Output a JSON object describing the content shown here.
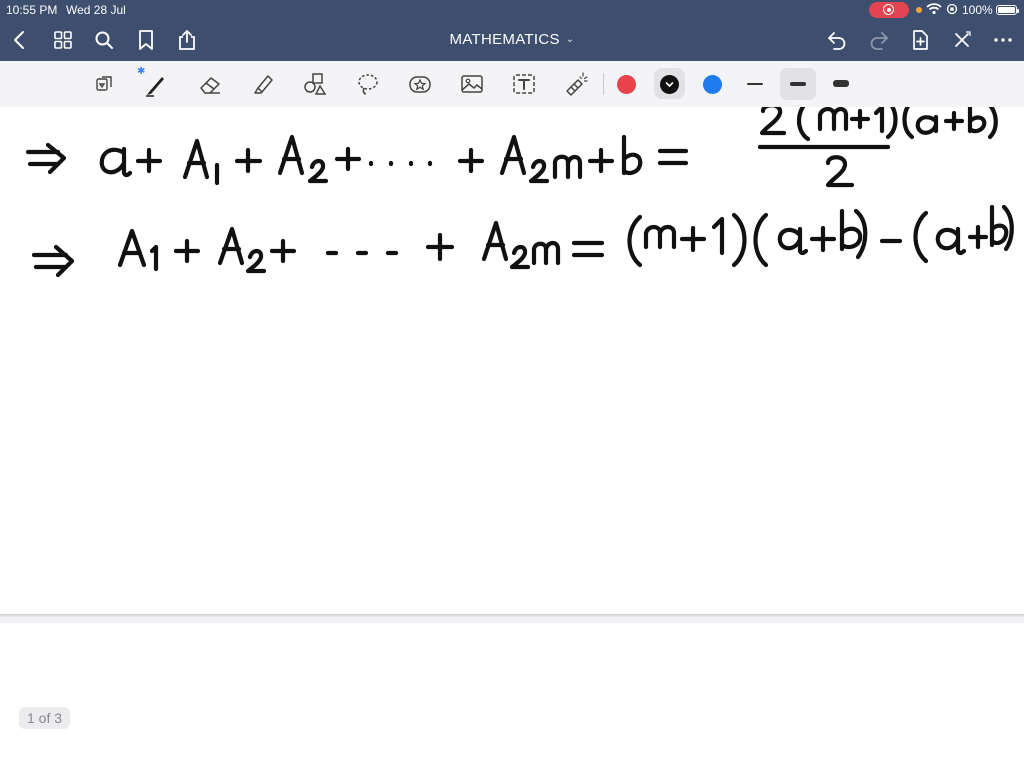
{
  "status": {
    "time": "10:55 PM",
    "date": "Wed 28 Jul",
    "battery": "100%"
  },
  "nav": {
    "title": "MATHEMATICS",
    "title_chevron": "⌄",
    "icons": [
      "back-icon",
      "grid-icon",
      "search-icon",
      "bookmark-icon",
      "share-icon",
      "undo-icon",
      "redo-icon",
      "add-page-icon",
      "close-icon",
      "more-icon"
    ]
  },
  "toolbar": {
    "tools": [
      "lasso-icon",
      "pen-icon",
      "eraser-icon",
      "highlighter-icon",
      "shapes-icon",
      "lasso-select-icon",
      "sticker-icon",
      "image-icon",
      "text-icon",
      "laser-pointer-icon"
    ],
    "bluetooth_glyph": "✱",
    "colors": [
      "#e8424d",
      "#111111",
      "#1f7bf0"
    ],
    "selected_color": "#111111"
  },
  "handwriting": {
    "line1_prefix": "⇒",
    "line2_prefix": "⇒"
  },
  "page_indicator": "1 of 3"
}
